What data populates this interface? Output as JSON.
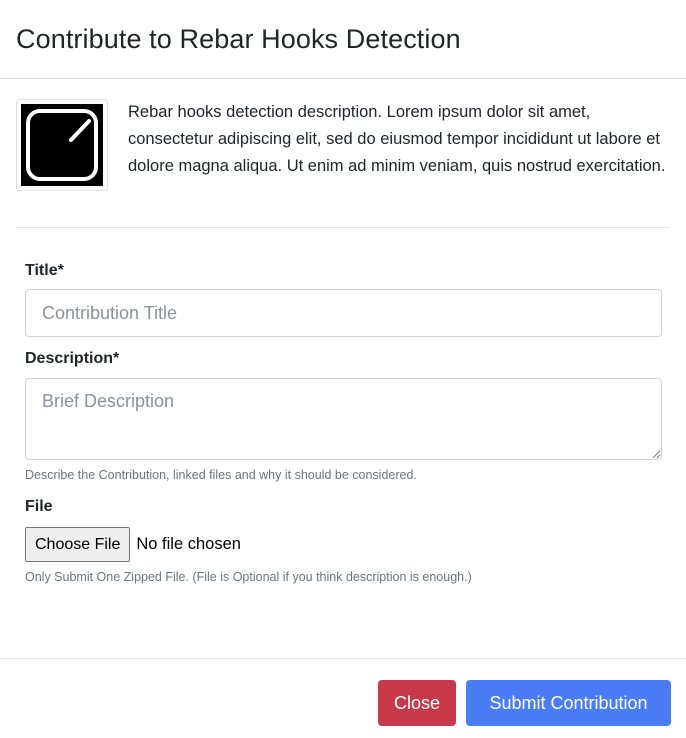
{
  "modal": {
    "title": "Contribute to Rebar Hooks Detection",
    "description": "Rebar hooks detection description. Lorem ipsum dolor sit amet, consectetur adipiscing elit, sed do eiusmod tempor incididunt ut labore et dolore magna aliqua. Ut enim ad minim veniam, quis nostrud exercitation.",
    "thumbnail_icon": "rebar-hook-icon"
  },
  "form": {
    "title_label": "Title*",
    "title_placeholder": "Contribution Title",
    "description_label": "Description*",
    "description_placeholder": "Brief Description",
    "description_help": "Describe the Contribution, linked files and why it should be considered.",
    "file_label": "File",
    "file_button": "Choose File",
    "file_status": "No file chosen",
    "file_help": "Only Submit One Zipped File. (File is Optional if you think description is enough.)"
  },
  "footer": {
    "close_label": "Close",
    "submit_label": "Submit Contribution"
  },
  "colors": {
    "close": "#c63a4c",
    "submit": "#4a7cf6"
  }
}
